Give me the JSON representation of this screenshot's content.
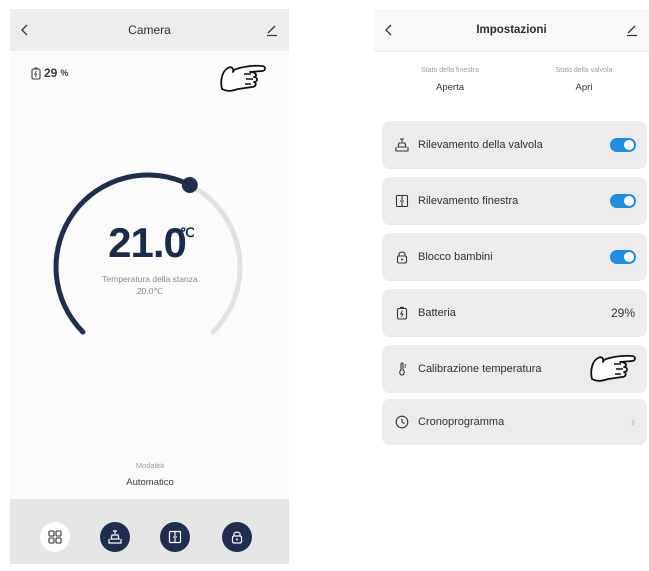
{
  "left_screen": {
    "header": {
      "title": "Camera"
    },
    "battery": {
      "value": "29",
      "unit": "%"
    },
    "temperature": {
      "setpoint": "21.0",
      "unit": "℃",
      "setpoint_fraction": 0.6
    },
    "room": {
      "label": "Temperatura della stanza",
      "value": "20.0℃"
    },
    "mode": {
      "label": "Modalità",
      "value": "Automatico"
    },
    "bottom_nav": [
      "grid-icon",
      "valve-icon",
      "window-icon",
      "lock-icon"
    ]
  },
  "right_screen": {
    "header": {
      "title": "Impostazioni"
    },
    "window_status": {
      "label": "Stato della finestra",
      "value": "Aperta"
    },
    "valve_status": {
      "label": "Stato della valvola",
      "value": "Apri"
    },
    "settings": [
      {
        "icon": "valve-icon",
        "label": "Rilevamento della valvola",
        "toggle": true
      },
      {
        "icon": "window-icon",
        "label": "Rilevamento finestra",
        "toggle": true
      },
      {
        "icon": "lock-icon",
        "label": "Blocco bambini",
        "toggle": true
      },
      {
        "icon": "battery-icon",
        "label": "Batteria",
        "value": "29%"
      },
      {
        "icon": "thermometer-icon",
        "label": "Calibrazione temperatura"
      },
      {
        "icon": "clock-icon",
        "label": "Cronoprogramma"
      }
    ]
  },
  "colors": {
    "accent_navy": "#1f2d50",
    "toggle_blue": "#1e8ee0",
    "row_background": "#ececec",
    "track_grey": "#e2e2e2"
  }
}
